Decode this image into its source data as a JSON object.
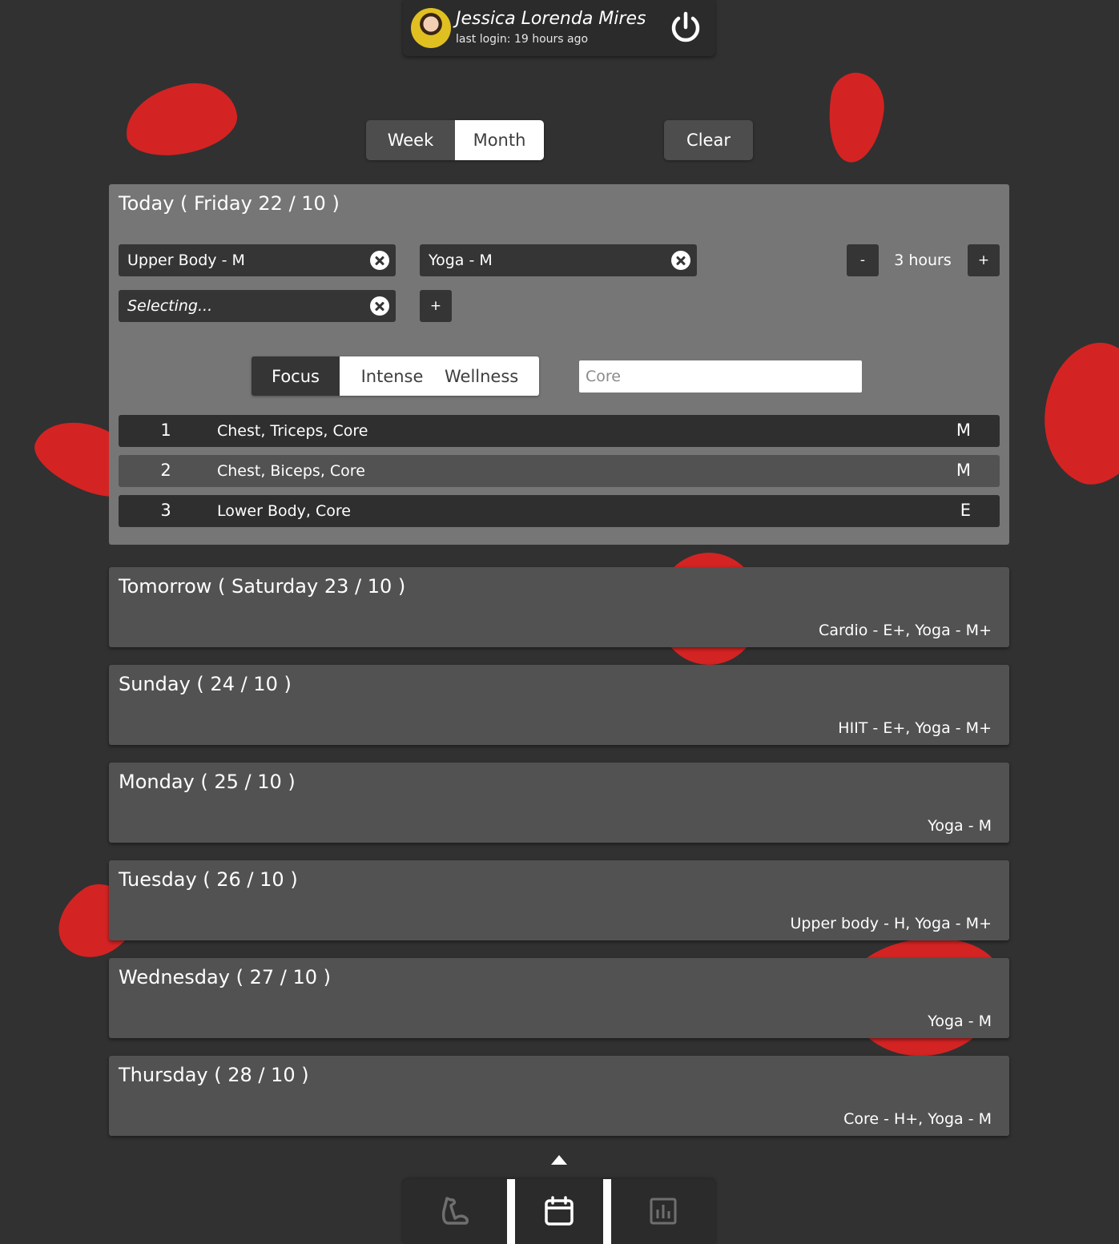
{
  "user": {
    "name": "Jessica Lorenda Mires",
    "last_login": "last login:  19 hours ago"
  },
  "view_toggle": {
    "week": "Week",
    "month": "Month",
    "selected": "Month"
  },
  "clear_label": "Clear",
  "today": {
    "title": "Today ( Friday 22 / 10 )",
    "chips": [
      "Upper Body - M",
      "Yoga - M"
    ],
    "selecting": "Selecting...",
    "add_label": "+",
    "hours": {
      "minus": "-",
      "value": "3 hours",
      "plus": "+"
    },
    "filters": {
      "options": [
        "Focus",
        "Intense",
        "Wellness"
      ],
      "selected": "Focus"
    },
    "search_placeholder": "Core",
    "options": [
      {
        "num": "1",
        "desc": "Chest, Triceps, Core",
        "level": "M"
      },
      {
        "num": "2",
        "desc": "Chest, Biceps, Core",
        "level": "M"
      },
      {
        "num": "3",
        "desc": "Lower Body, Core",
        "level": "E"
      }
    ]
  },
  "days": [
    {
      "title": "Tomorrow ( Saturday 23 / 10 )",
      "summary": "Cardio - E+, Yoga - M+"
    },
    {
      "title": "Sunday ( 24 / 10 )",
      "summary": "HIIT - E+, Yoga - M+"
    },
    {
      "title": "Monday ( 25 / 10 )",
      "summary": "Yoga - M"
    },
    {
      "title": "Tuesday ( 26 / 10 )",
      "summary": "Upper body - H, Yoga - M+"
    },
    {
      "title": "Wednesday ( 27 / 10 )",
      "summary": "Yoga - M"
    },
    {
      "title": "Thursday ( 28 / 10 )",
      "summary": "Core - H+, Yoga - M"
    }
  ],
  "colors": {
    "background": "#313131",
    "accent_blob": "#d42323",
    "panel": "#767676",
    "card": "#525252",
    "chip": "#353535"
  },
  "nav": {
    "items": [
      "exercise-icon",
      "calendar-icon",
      "stats-icon"
    ],
    "active": "calendar-icon"
  }
}
